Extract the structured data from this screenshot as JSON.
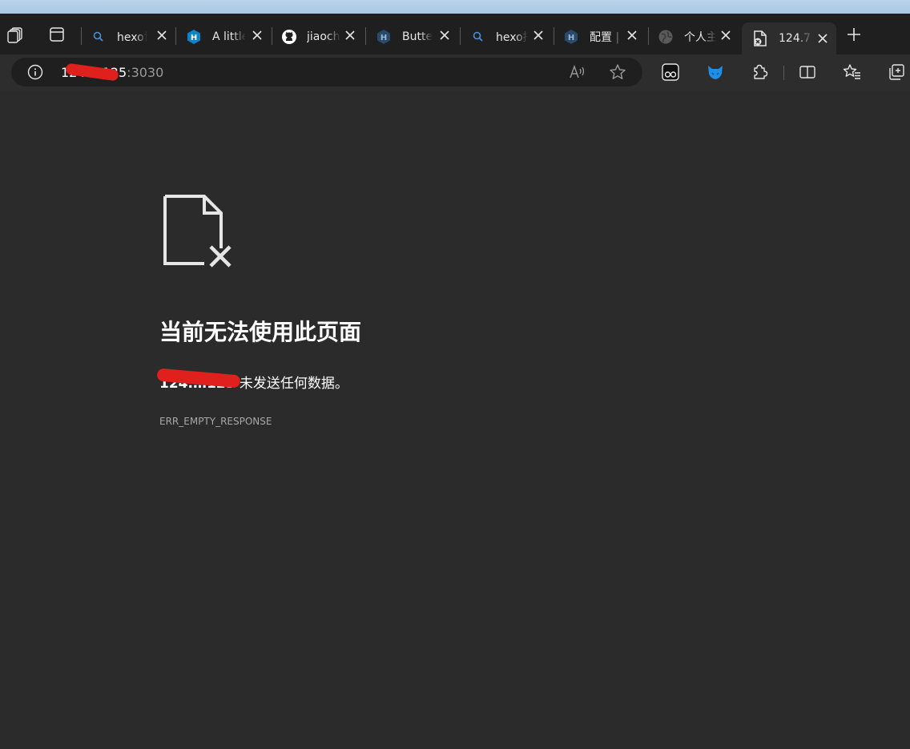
{
  "tabs": [
    {
      "title": "hexo博",
      "icon": "search-icon",
      "active": false
    },
    {
      "title": "A little",
      "icon": "hexo-h-icon",
      "active": false
    },
    {
      "title": "jiaoch",
      "icon": "github-icon",
      "active": false
    },
    {
      "title": "Butte",
      "icon": "hexo-h-icon",
      "active": false
    },
    {
      "title": "hexo搭",
      "icon": "search-icon",
      "active": false
    },
    {
      "title": "配置 |",
      "icon": "hexo-h-icon",
      "active": false
    },
    {
      "title": "个人主",
      "icon": "globe-icon",
      "active": false
    },
    {
      "title": "124.7",
      "icon": "error-page-icon",
      "active": true
    }
  ],
  "address_bar": {
    "host": "124.…125",
    "port": ":3030"
  },
  "error_page": {
    "title": "当前无法使用此页面",
    "host": "124.…125",
    "message": " 未发送任何数据。",
    "code": "ERR_EMPTY_RESPONSE"
  },
  "colors": {
    "page_background": "#2b2b2b",
    "tab_strip": "#1f1f1f",
    "toolbar": "#2d2d2d",
    "redaction": "#e0201c",
    "hexo_blue": "#0e83cd",
    "extension_blue": "#1e8fe6"
  }
}
